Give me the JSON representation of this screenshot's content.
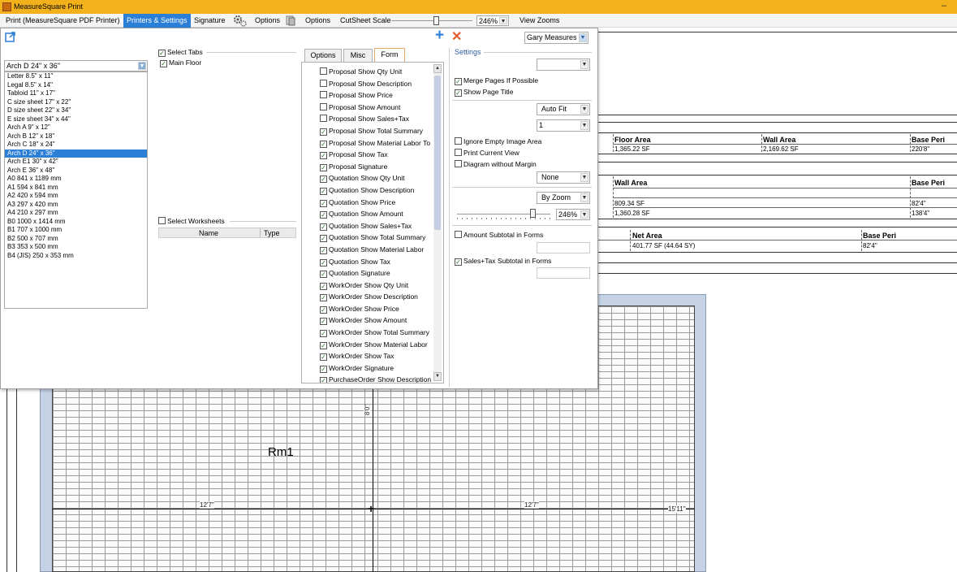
{
  "app": {
    "title": "MeasureSquare Print"
  },
  "menu": {
    "print_label": "Print (MeasureSquare PDF Printer)",
    "printers_label": "Printers & Settings",
    "signature_label": "Signature",
    "options1_label": "Options",
    "options2_label": "Options",
    "cutsheet_label": "CutSheet Scale",
    "zoom_value": "246%",
    "view_zooms_label": "View Zooms"
  },
  "paper": {
    "selected": "Arch D 24\" x 36\"",
    "options": [
      "Letter 8.5\" x 11\"",
      "Legal 8.5\" x 14\"",
      "Tabloid 11\" x 17\"",
      "C size sheet 17\" x 22\"",
      "D size sheet 22\" x 34\"",
      "E size sheet 34\" x 44\"",
      "Arch A 9\" x 12\"",
      "Arch B 12\" x 18\"",
      "Arch C 18\" x 24\"",
      "Arch D 24\" x 36\"",
      "Arch E1 30\" x 42\"",
      "Arch E 36\" x 48\"",
      "A0 841 x 1189 mm",
      "A1 594 x 841 mm",
      "A2 420 x 594 mm",
      "A3 297 x 420 mm",
      "A4 210 x 297 mm",
      "B0 1000 x 1414 mm",
      "B1 707 x 1000 mm",
      "B2 500 x 707 mm",
      "B3 353 x 500 mm",
      "B4 (JIS) 250 x 353 mm"
    ]
  },
  "tabs_section": {
    "select_tabs": "Select Tabs",
    "main_floor": "Main Floor"
  },
  "worksheets": {
    "select_label": "Select Worksheets",
    "col_name": "Name",
    "col_type": "Type"
  },
  "form_tabs": [
    "Options",
    "Misc",
    "Form"
  ],
  "form_items": [
    "Proposal Show Qty Unit",
    "Proposal Show Description",
    "Proposal Show Price",
    "Proposal Show Amount",
    "Proposal Show Sales+Tax",
    "Proposal Show Total Summary",
    "Proposal Show Material Labor To",
    "Proposal Show Tax",
    "Proposal Signature",
    "Quotation Show Qty Unit",
    "Quotation Show Description",
    "Quotation Show Price",
    "Quotation Show Amount",
    "Quotation Show Sales+Tax",
    "Quotation Show Total Summary",
    "Quotation Show Material Labor",
    "Quotation Show Tax",
    "Quotation Signature",
    "WorkOrder Show Qty Unit",
    "WorkOrder Show Description",
    "WorkOrder Show Price",
    "WorkOrder Show Amount",
    "WorkOrder Show Total Summary",
    "WorkOrder Show Material Labor",
    "WorkOrder Show Tax",
    "WorkOrder Signature",
    "PurchaseOrder Show Description"
  ],
  "form_checked": [
    false,
    false,
    false,
    false,
    false,
    true,
    true,
    true,
    true,
    true,
    true,
    true,
    true,
    true,
    true,
    true,
    true,
    true,
    true,
    true,
    true,
    true,
    true,
    true,
    true,
    true,
    true
  ],
  "settings": {
    "title": "Settings",
    "user": "Gary Measures I",
    "merge_pages": "Merge Pages If Possible",
    "show_page_title": "Show Page Title",
    "fit": "Auto Fit",
    "count": "1",
    "ignore_empty": "Ignore Empty Image Area",
    "print_current": "Print Current View",
    "diagram_no_margin": "Diagram without Margin",
    "none": "None",
    "by_zoom": "By Zoom",
    "zoom": "246%",
    "amount_subtotal": "Amount Subtotal in Forms",
    "salestax_subtotal": "Sales+Tax Subtotal in Forms"
  },
  "report": {
    "table1": {
      "floor_area": "Floor Area",
      "wall_area": "Wall Area",
      "base_peri": "Base Peri",
      "v1": "1,365.22 SF",
      "v2": "2,169.62 SF",
      "v3": "220'8\""
    },
    "table2": {
      "wall_area": "Wall Area",
      "base_peri": "Base Peri",
      "r1a": "809.34 SF",
      "r1b": "82'4\"",
      "r2a": "1,360.28 SF",
      "r2b": "138'4\""
    },
    "table3": {
      "net_area": "Net Area",
      "base_peri": "Base Peri",
      "v1": "401.77 SF (44.64 SY)",
      "v2": "82'4\""
    }
  },
  "drawing": {
    "room": "Rm1",
    "dim_left": "12'7\"",
    "dim_right": "12'7\"",
    "dim_total": "15'11\"",
    "dim_vertical": "8'0\""
  }
}
